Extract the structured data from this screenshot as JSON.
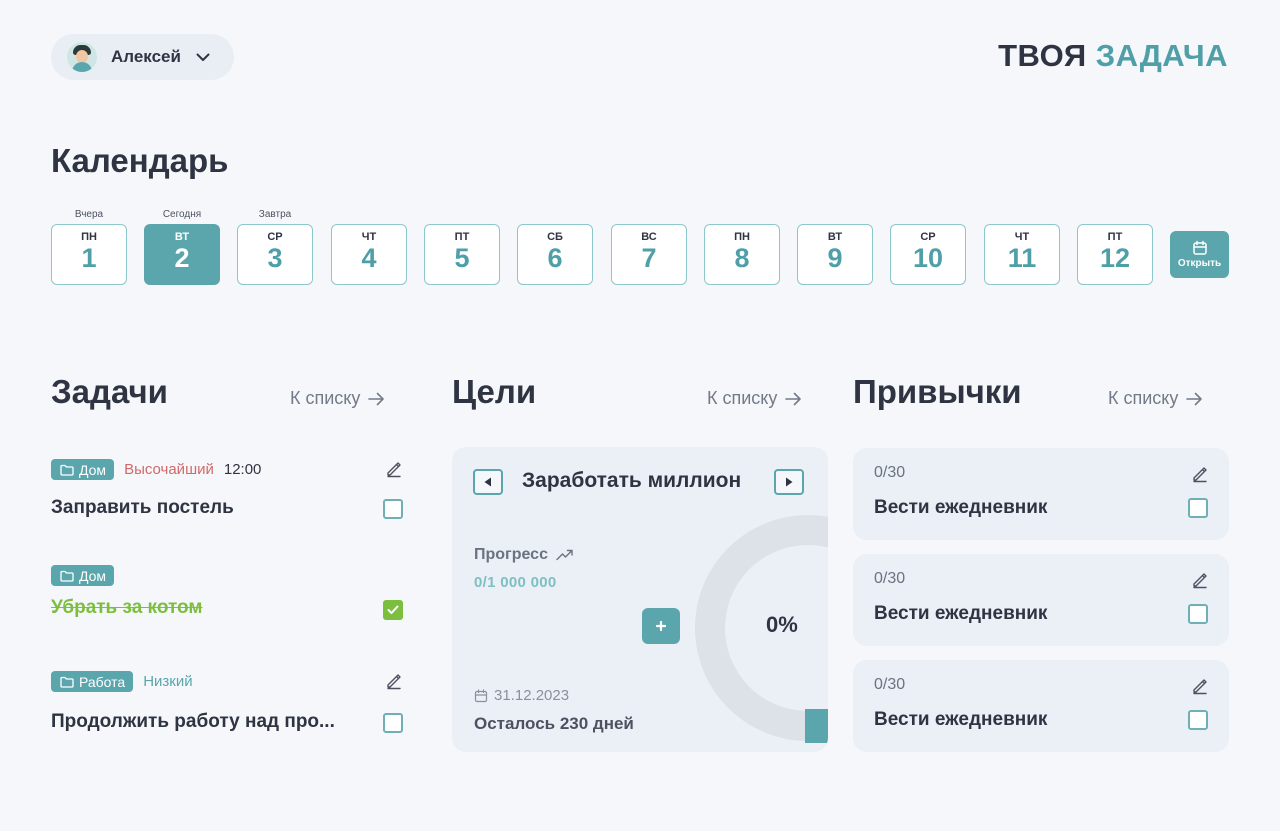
{
  "header": {
    "user_name": "Алексей",
    "logo_part1": "ТВОЯ",
    "logo_part2": "ЗАДАЧА"
  },
  "calendar": {
    "title": "Календарь",
    "open_label": "Открыть",
    "captions": {
      "yesterday": "Вчера",
      "today": "Сегодня",
      "tomorrow": "Завтра"
    },
    "days": [
      {
        "dow": "ПН",
        "num": "1"
      },
      {
        "dow": "ВТ",
        "num": "2"
      },
      {
        "dow": "СР",
        "num": "3"
      },
      {
        "dow": "ЧТ",
        "num": "4"
      },
      {
        "dow": "ПТ",
        "num": "5"
      },
      {
        "dow": "СБ",
        "num": "6"
      },
      {
        "dow": "ВС",
        "num": "7"
      },
      {
        "dow": "ПН",
        "num": "8"
      },
      {
        "dow": "ВТ",
        "num": "9"
      },
      {
        "dow": "СР",
        "num": "10"
      },
      {
        "dow": "ЧТ",
        "num": "11"
      },
      {
        "dow": "ПТ",
        "num": "12"
      }
    ]
  },
  "tasks": {
    "title": "Задачи",
    "to_list": "К списку",
    "items": [
      {
        "tag": "Дом",
        "priority": "Высочайший",
        "time": "12:00",
        "title": "Заправить постель",
        "done": false
      },
      {
        "tag": "Дом",
        "title": "Убрать за котом",
        "done": true
      },
      {
        "tag": "Работа",
        "priority": "Низкий",
        "title": "Продолжить работу над про...",
        "done": false
      }
    ]
  },
  "goals": {
    "title": "Цели",
    "to_list": "К списку",
    "name": "Заработать миллион",
    "progress_label": "Прогресс",
    "progress_value": "0/1 000 000",
    "percent": "0%",
    "date": "31.12.2023",
    "remaining": "Осталось 230 дней"
  },
  "habits": {
    "title": "Привычки",
    "to_list": "К списку",
    "items": [
      {
        "count": "0/30",
        "title": "Вести ежедневник"
      },
      {
        "count": "0/30",
        "title": "Вести ежедневник"
      },
      {
        "count": "0/30",
        "title": "Вести ежедневник"
      }
    ]
  },
  "colors": {
    "accent": "#5aa6ac",
    "text": "#2f3442",
    "done": "#7cbf3e",
    "high": "#d06a6a"
  }
}
